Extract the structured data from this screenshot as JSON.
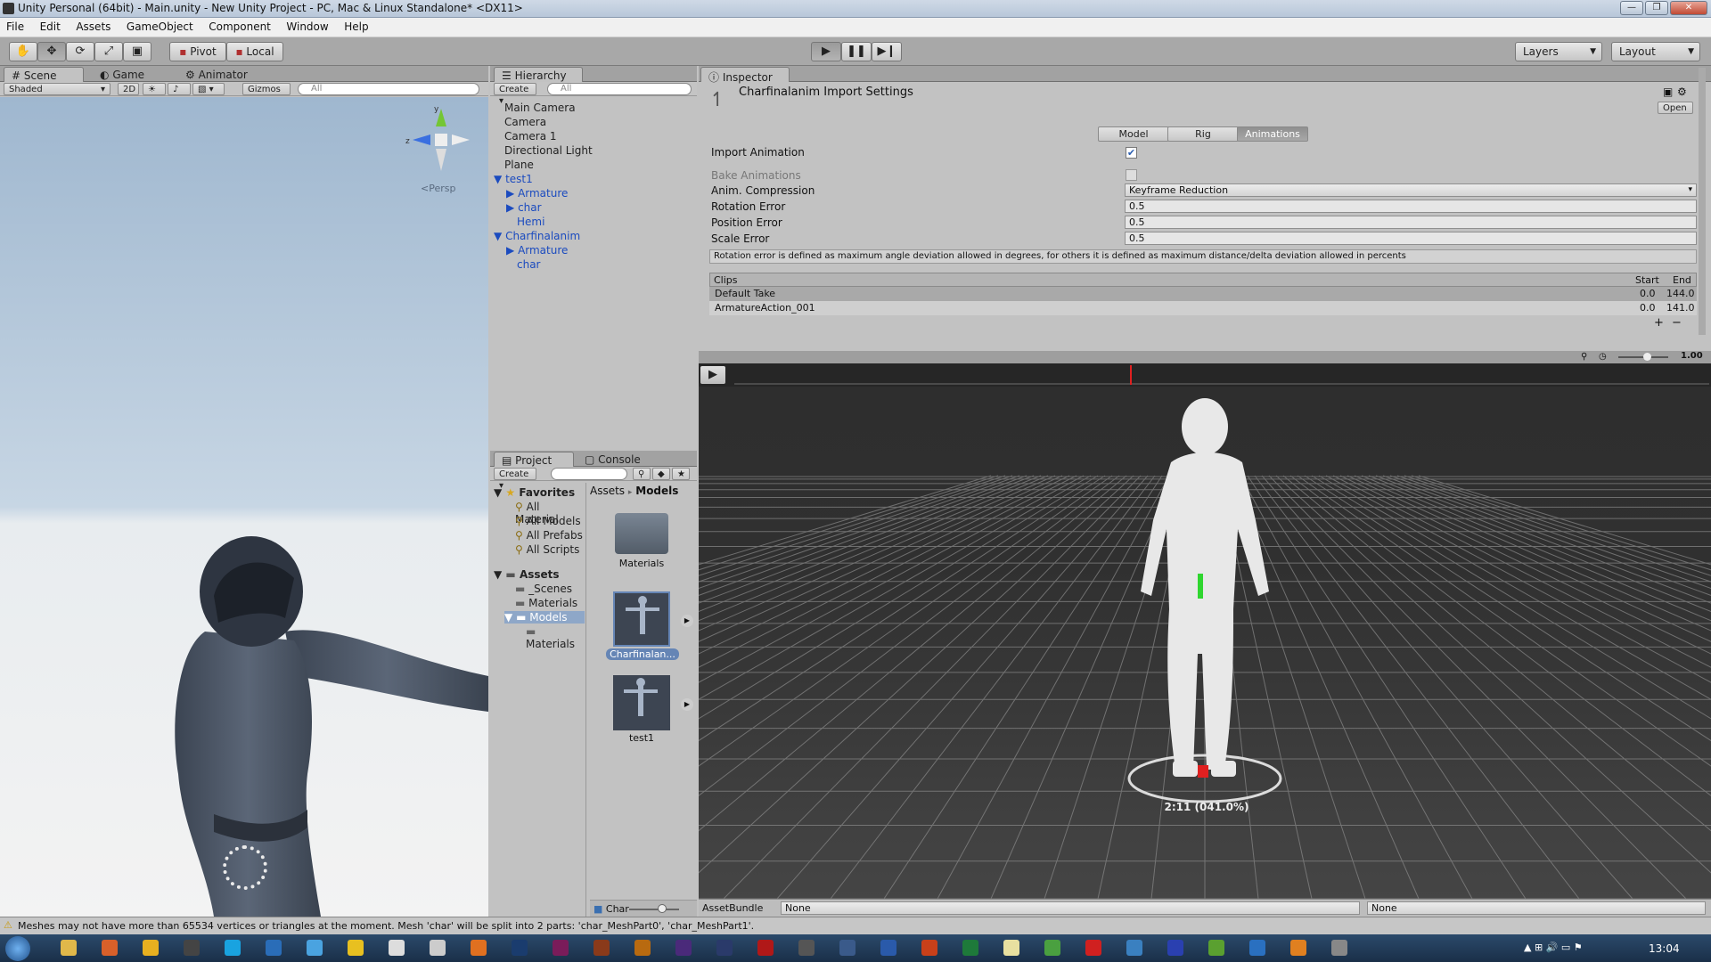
{
  "window": {
    "title": "Unity Personal (64bit) - Main.unity - New Unity Project - PC, Mac & Linux Standalone* <DX11>",
    "controls": [
      "—",
      "❐",
      "✕"
    ]
  },
  "menu": [
    "File",
    "Edit",
    "Assets",
    "GameObject",
    "Component",
    "Window",
    "Help"
  ],
  "toolbar": {
    "pivot": "Pivot",
    "local": "Local",
    "layers": "Layers",
    "layout": "Layout"
  },
  "scene": {
    "tabs": [
      "Scene",
      "Game",
      "Animator"
    ],
    "shading": "Shaded",
    "mode_2d": "2D",
    "gizmos": "Gizmos",
    "search_placeholder": "All",
    "persp_label": "Persp",
    "gizmo_axes": {
      "y": "y",
      "z": "z"
    }
  },
  "hierarchy": {
    "tab": "Hierarchy",
    "create": "Create",
    "search_placeholder": "All",
    "items": [
      "Main Camera",
      "Camera",
      "Camera 1",
      "Directional Light",
      "Plane",
      "test1",
      "Armature",
      "char",
      "Hemi",
      "Charfinalanim",
      "Armature",
      "char"
    ]
  },
  "project": {
    "tabs": [
      "Project",
      "Console"
    ],
    "create": "Create",
    "favorites_label": "Favorites",
    "favorites": [
      "All Material",
      "All Models",
      "All Prefabs",
      "All Scripts"
    ],
    "assets_label": "Assets",
    "assets_tree": [
      "_Scenes",
      "Materials",
      "Models",
      "Materials"
    ],
    "breadcrumb": [
      "Assets",
      "Models"
    ],
    "thumbs": [
      "Materials",
      "Charfinalan...",
      "test1"
    ],
    "footer": "Char"
  },
  "inspector": {
    "tab": "Inspector",
    "title": "Charfinalanim Import Settings",
    "open": "Open",
    "tabs": [
      "Model",
      "Rig",
      "Animations"
    ],
    "import_animation": "Import Animation",
    "bake_animations": "Bake Animations",
    "anim_compression_label": "Anim. Compression",
    "anim_compression_value": "Keyframe Reduction",
    "rotation_error_label": "Rotation Error",
    "rotation_error": "0.5",
    "position_error_label": "Position Error",
    "position_error": "0.5",
    "scale_error_label": "Scale Error",
    "scale_error": "0.5",
    "help_text": "Rotation error is defined as maximum angle deviation allowed in degrees, for others it is defined as maximum distance/delta deviation allowed in percents",
    "clips_header": {
      "name": "Clips",
      "start": "Start",
      "end": "End"
    },
    "clips": [
      {
        "name": "Default Take",
        "start": "0.0",
        "end": "144.0"
      },
      {
        "name": "ArmatureAction_001",
        "start": "0.0",
        "end": "141.0"
      }
    ],
    "add": "+",
    "remove": "−"
  },
  "preview": {
    "speed": "1.00",
    "time": "2:11 (041.0%)",
    "assetbundle_label": "AssetBundle",
    "assetbundle_value": "None",
    "variant_value": "None"
  },
  "status": {
    "message": "Meshes may not have more than 65534 vertices or triangles at the moment. Mesh 'char' will be split into 2 parts: 'char_MeshPart0', 'char_MeshPart1'."
  },
  "taskbar": {
    "clock": "13:04"
  },
  "colors": {
    "accent_blue": "#1b4bbf",
    "panel_gray": "#c2c2c2",
    "toolbar_gray": "#a8a8a8",
    "preview_dark": "#262626"
  }
}
